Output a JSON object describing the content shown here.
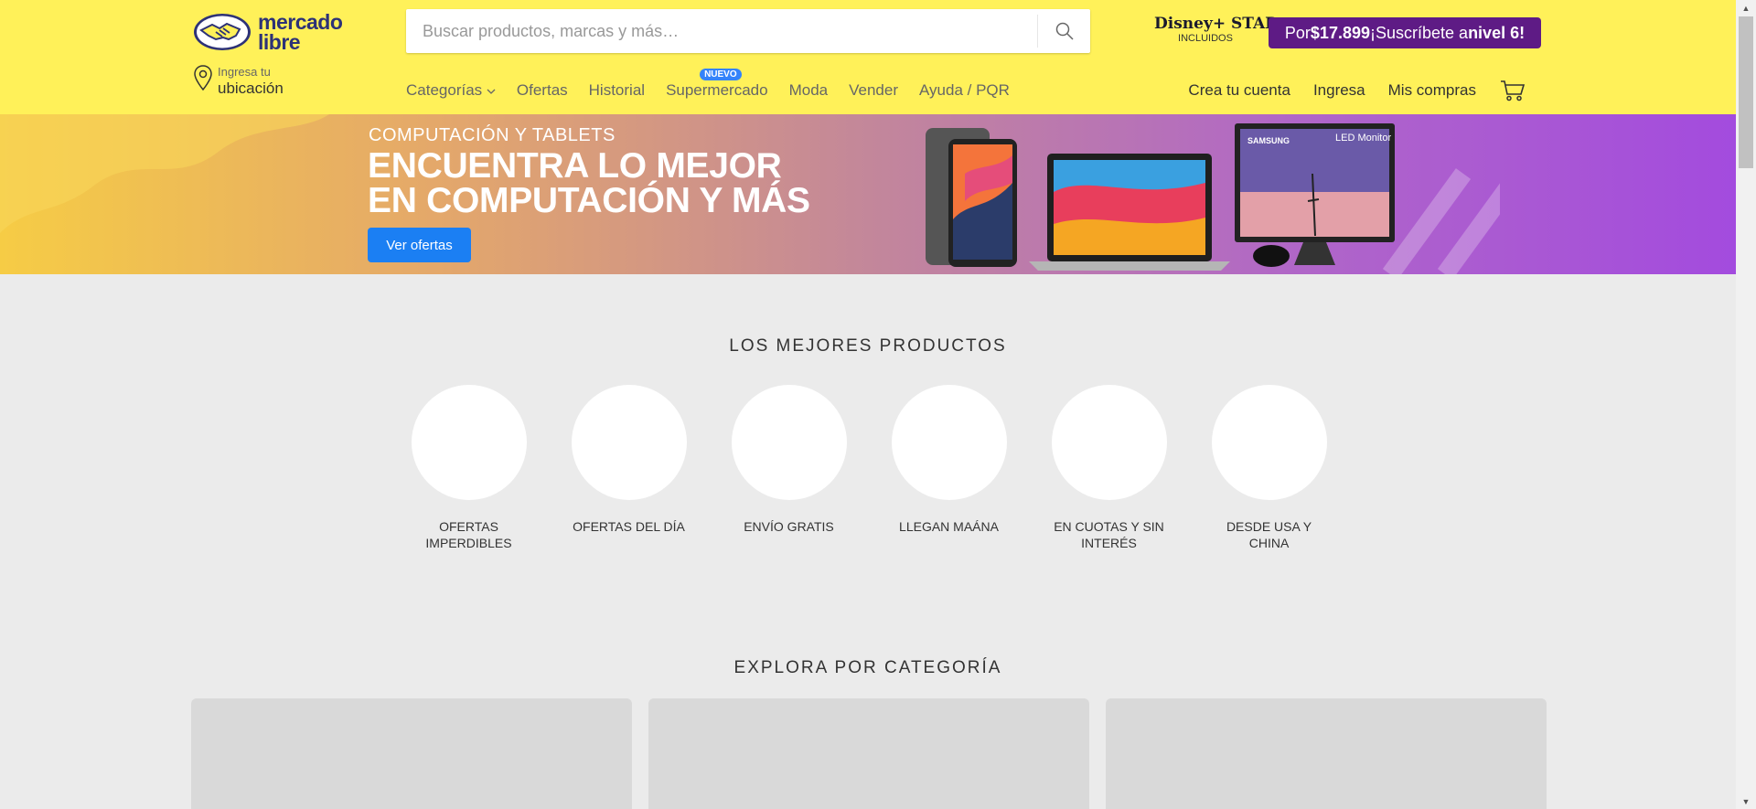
{
  "header": {
    "logo": {
      "line1": "mercado",
      "line2": "libre"
    },
    "location": {
      "small": "Ingresa tu",
      "big": "ubicación"
    },
    "search": {
      "placeholder": "Buscar productos, marcas y más…"
    },
    "disney": {
      "brand": "Disney+ STAR+",
      "sub": "INCLUIDOS"
    },
    "promo": {
      "prefix": "Por ",
      "price": "$17.899",
      "middle": " ¡Suscríbete a ",
      "level": "nivel 6",
      "suffix": "!"
    },
    "nav": [
      {
        "label": "Categorías"
      },
      {
        "label": "Ofertas"
      },
      {
        "label": "Historial"
      },
      {
        "label": "Supermercado",
        "badge": "NUEVO"
      },
      {
        "label": "Moda"
      },
      {
        "label": "Vender"
      },
      {
        "label": "Ayuda / PQR"
      }
    ],
    "account": {
      "create": "Crea tu cuenta",
      "login": "Ingresa",
      "purchases": "Mis compras"
    }
  },
  "banner": {
    "category": "COMPUTACIÓN Y TABLETS",
    "title_line1": "ENCUENTRA LO MEJOR",
    "title_line2": "EN COMPUTACIÓN Y MÁS",
    "button": "Ver ofertas",
    "monitor_brand": "SAMSUNG",
    "monitor_label": "LED Monitor"
  },
  "best_products": {
    "title": "LOS MEJORES PRODUCTOS",
    "items": [
      {
        "label": "OFERTAS IMPERDIBLES"
      },
      {
        "label": "OFERTAS DEL DÍA"
      },
      {
        "label": "ENVÍO GRATIS"
      },
      {
        "label": "LLEGAN MAÁNA"
      },
      {
        "label": "EN CUOTAS Y SIN INTERÉS"
      },
      {
        "label": "DESDE USA Y CHINA"
      }
    ]
  },
  "categories": {
    "title": "EXPLORA POR CATEGORÍA"
  },
  "colors": {
    "header_bg": "#fff159",
    "accent": "#3483fa",
    "promo_bg": "#5e1b85",
    "page_bg": "#ebebeb"
  }
}
